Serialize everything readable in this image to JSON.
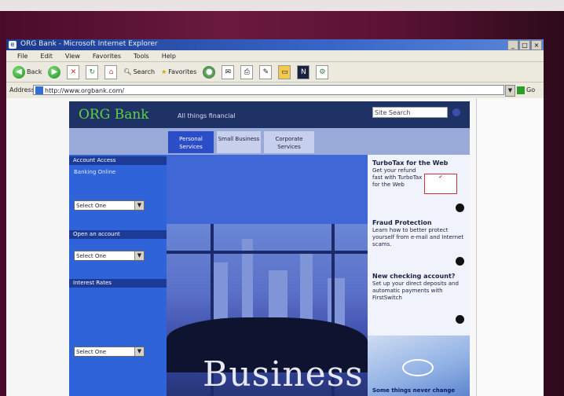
{
  "window": {
    "title": "ORG Bank - Microsoft Internet Explorer"
  },
  "menu": [
    "File",
    "Edit",
    "View",
    "Favorites",
    "Tools",
    "Help"
  ],
  "toolbar": {
    "back_label": "Back",
    "search_label": "Search",
    "favorites_label": "Favorites"
  },
  "address": {
    "label": "Address",
    "url": "http://www.orgbank.com/",
    "go_label": "Go"
  },
  "site": {
    "logo": "ORG Bank",
    "tagline": "All things financial",
    "search_placeholder": "Site Search",
    "tabs": [
      {
        "label": "Personal Services"
      },
      {
        "label": "Small Business"
      },
      {
        "label": "Corporate Services"
      }
    ],
    "hero_word": "Business",
    "sidebar": {
      "head1": "Account Access",
      "text1": "Banking Online",
      "select1": "Select One",
      "head2": "Open an account",
      "select2": "Select One",
      "head3": "Interest Rates",
      "select3": "Select One"
    },
    "promos": [
      {
        "title": "TurboTax for the Web",
        "body": "Get your refund fast with TurboTax for the Web"
      },
      {
        "title": "Fraud Protection",
        "body": "Learn how to better protect yourself from e-mail and Internet scams."
      },
      {
        "title": "New checking account?",
        "body": "Set up your direct deposits and automatic payments with FirstSwitch"
      }
    ],
    "photo_caption": "Some things never change"
  }
}
